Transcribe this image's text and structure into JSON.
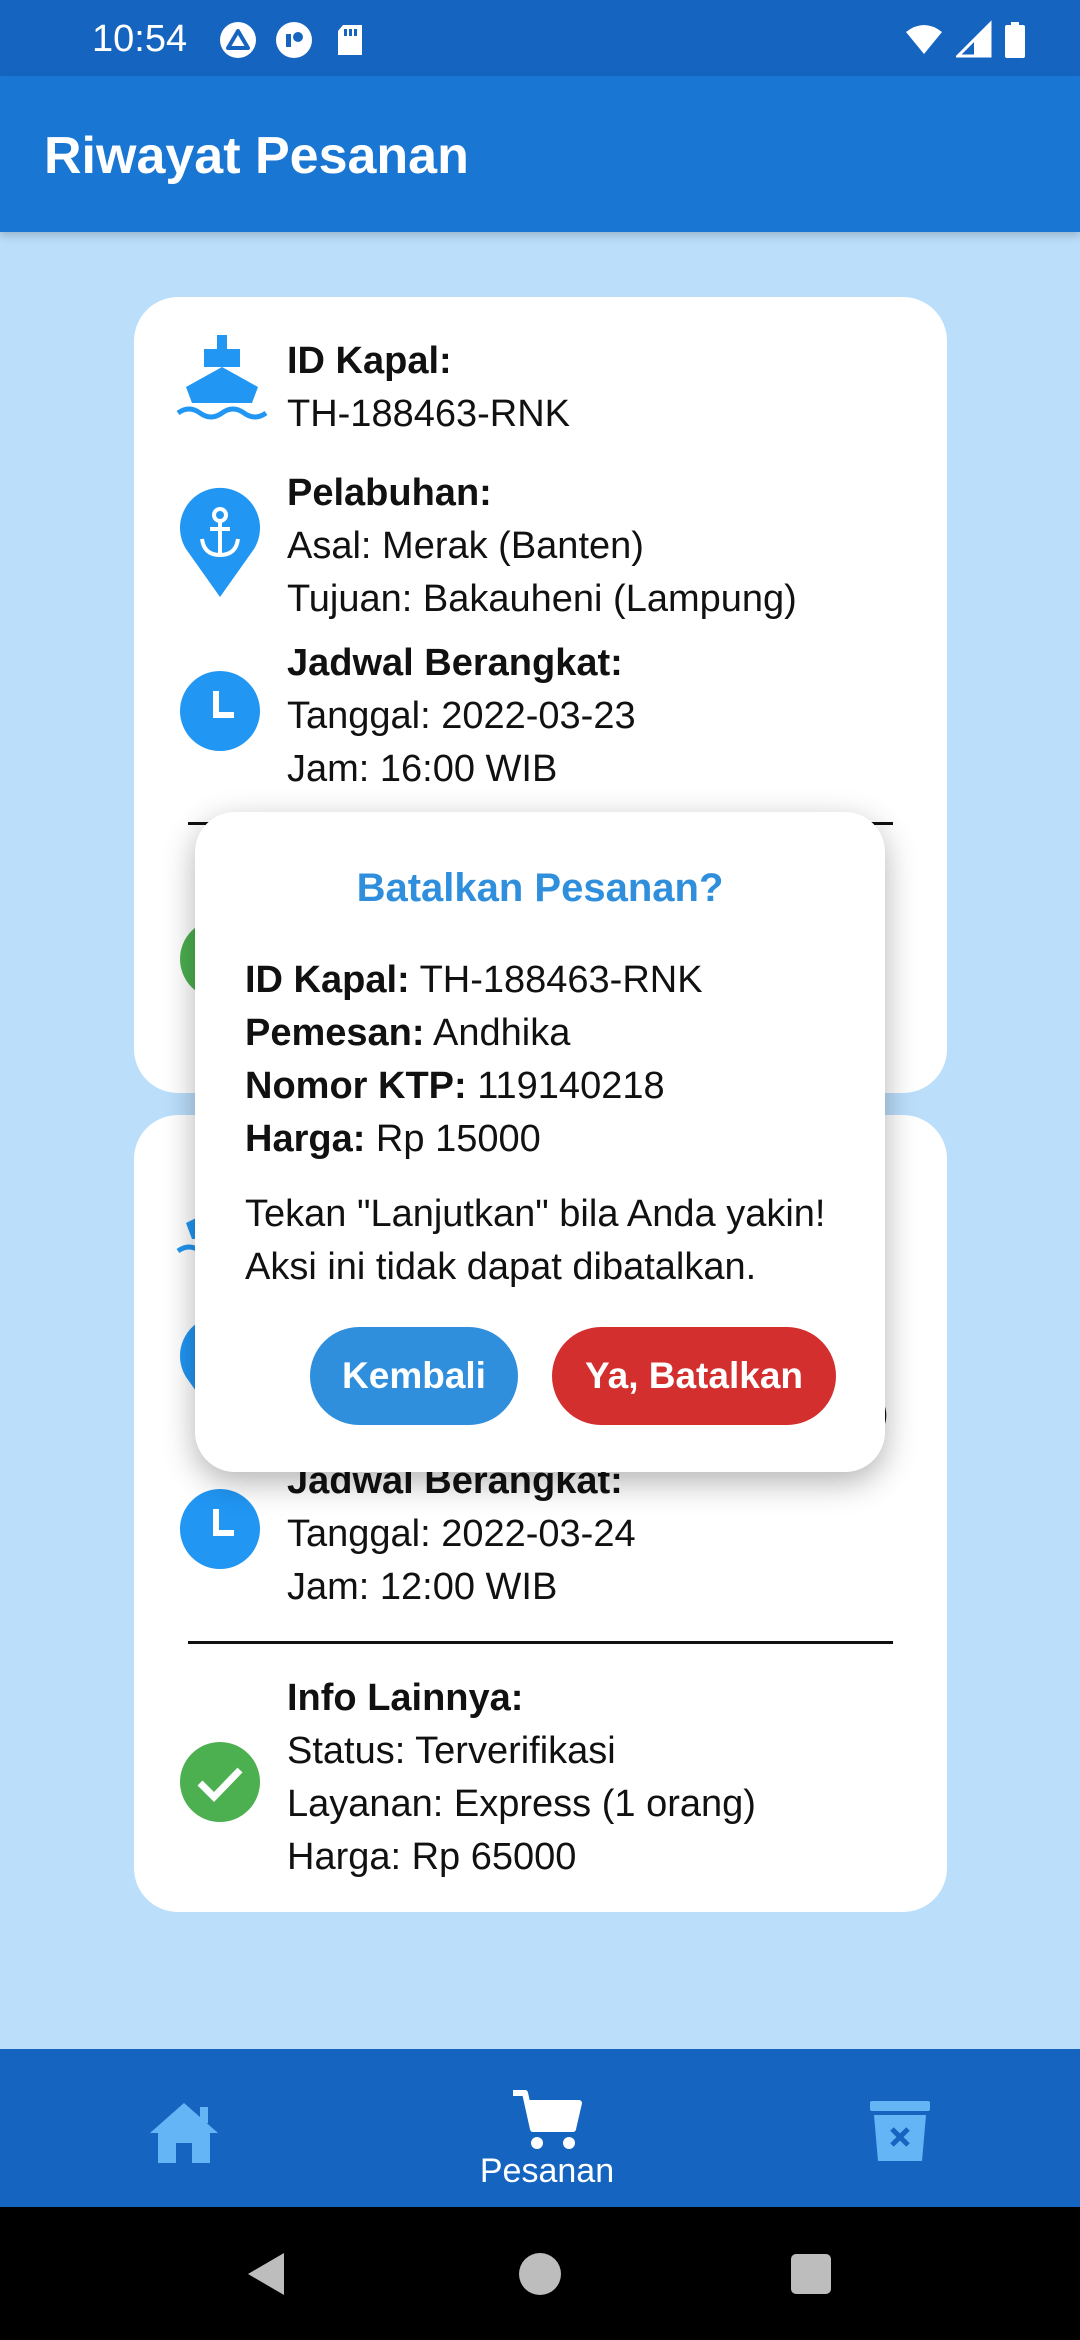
{
  "status_bar": {
    "time": "10:54",
    "icons": [
      "mountain-app-icon",
      "app-badge-icon",
      "sd-card-icon",
      "wifi-icon",
      "signal-icon",
      "battery-icon"
    ]
  },
  "app_bar": {
    "title": "Riwayat Pesanan"
  },
  "orders": [
    {
      "ship_label": "ID Kapal:",
      "ship_id": "TH-188463-RNK",
      "port_label": "Pelabuhan:",
      "origin": "Asal: Merak (Banten)",
      "destination": "Tujuan: Bakauheni (Lampung)",
      "schedule_label": "Jadwal Berangkat:",
      "date": "Tanggal: 2022-03-23",
      "time": "Jam: 16:00 WIB"
    },
    {
      "partial_port_text": ")",
      "schedule_label": "Jadwal Berangkat:",
      "date": "Tanggal: 2022-03-24",
      "time": "Jam: 12:00 WIB",
      "info_label": "Info Lainnya:",
      "status": "Status: Terverifikasi",
      "service": "Layanan: Express (1 orang)",
      "price": "Harga: Rp 65000"
    }
  ],
  "dialog": {
    "title": "Batalkan Pesanan?",
    "ship_key": "ID Kapal:",
    "ship_value": " TH-188463-RNK",
    "customer_key": "Pemesan:",
    "customer_value": " Andhika",
    "ktp_key": "Nomor KTP:",
    "ktp_value": " 119140218",
    "price_key": "Harga:",
    "price_value": " Rp 15000",
    "message_line1": "Tekan \"Lanjutkan\" bila Anda yakin!",
    "message_line2": "Aksi ini tidak dapat dibatalkan.",
    "back_button": "Kembali",
    "confirm_button": "Ya, Batalkan"
  },
  "bottom_nav": {
    "items": [
      {
        "icon": "home-icon",
        "label": ""
      },
      {
        "icon": "cart-icon",
        "label": "Pesanan"
      },
      {
        "icon": "cancel-bin-icon",
        "label": ""
      }
    ]
  },
  "colors": {
    "primary": "#1976d2",
    "primary_dark": "#1565c0",
    "background": "#bbdefb",
    "accent_blue": "#2196f3",
    "danger": "#d32f2f",
    "success": "#4caf50"
  }
}
